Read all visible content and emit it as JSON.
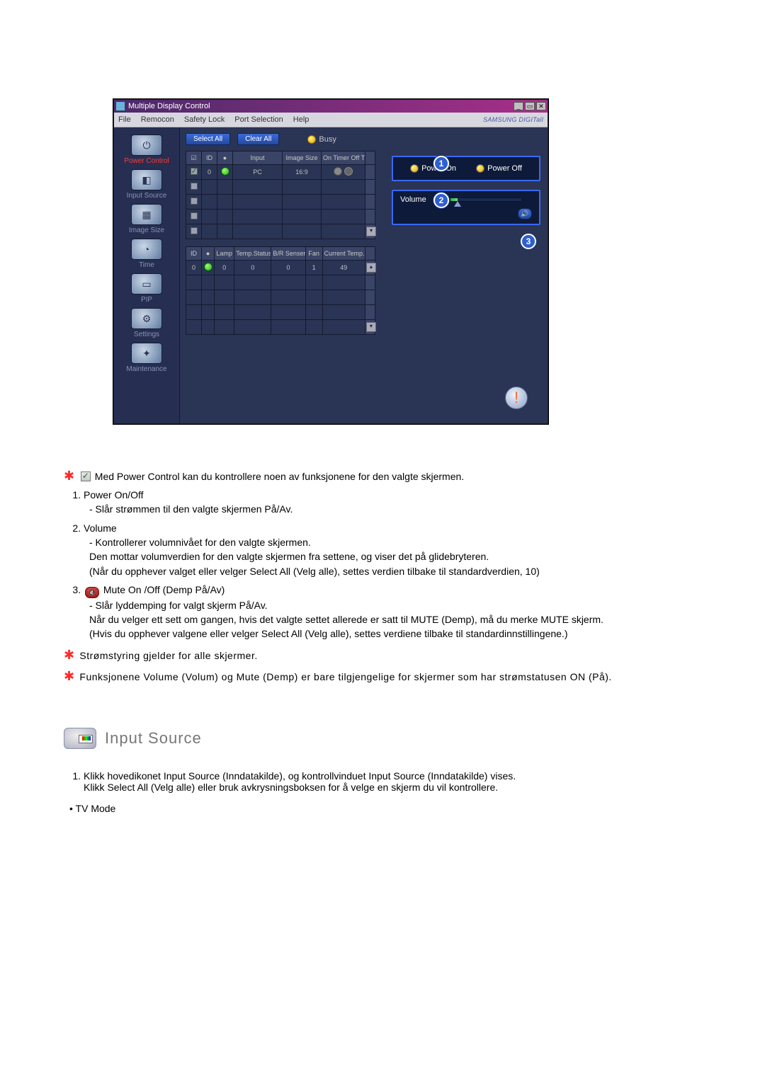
{
  "window": {
    "title": "Multiple Display Control",
    "menus": [
      "File",
      "Remocon",
      "Safety Lock",
      "Port Selection",
      "Help"
    ],
    "brand": "SAMSUNG DIGITall",
    "sidebar": [
      {
        "label": "Power Control",
        "glyph": "⏻"
      },
      {
        "label": "Input Source",
        "glyph": "◧"
      },
      {
        "label": "Image Size",
        "glyph": "▦"
      },
      {
        "label": "Time",
        "glyph": "◔"
      },
      {
        "label": "PIP",
        "glyph": "▭"
      },
      {
        "label": "Settings",
        "glyph": "⚙"
      },
      {
        "label": "Maintenance",
        "glyph": "✦"
      }
    ],
    "buttons": {
      "select_all": "Select All",
      "clear_all": "Clear All"
    },
    "busy_label": "Busy",
    "grid1": {
      "headers": [
        "",
        "ID",
        "",
        "Input",
        "Image Size",
        "On Timer Off T"
      ],
      "checkbox_header_glyph": "☑",
      "status_header_glyph": "●",
      "row": {
        "checked": true,
        "id": "0",
        "input": "PC",
        "image_size": "16:9"
      }
    },
    "grid2": {
      "headers": [
        "ID",
        "",
        "Lamp",
        "Temp.Status",
        "B/R Senser",
        "Fan",
        "Current Temp."
      ],
      "row": {
        "id": "0",
        "lamp": "0",
        "temp_status": "0",
        "br_sensor": "0",
        "fan": "1",
        "current_temp": "49"
      }
    },
    "panel_power": {
      "on": "Power On",
      "off": "Power Off"
    },
    "panel_volume": {
      "label": "Volume",
      "value": "10"
    },
    "callouts": {
      "c1": "1",
      "c2": "2",
      "c3": "3"
    },
    "alert_glyph": "!"
  },
  "instructions": {
    "intro": "Med Power Control kan du kontrollere noen av funksjonene for den valgte skjermen.",
    "items": [
      {
        "title": "Power On/Off",
        "lines": [
          "- Slår strømmen til den valgte skjermen På/Av."
        ]
      },
      {
        "title": "Volume",
        "lines": [
          "- Kontrollerer volumnivået for den valgte skjermen.",
          "Den mottar volumverdien for den valgte skjermen fra settene, og viser det på glidebryteren.",
          "(Når du opphever valget eller velger Select All (Velg alle), settes verdien tilbake til standardverdien, 10)"
        ]
      },
      {
        "title": "Mute On /Off (Demp På/Av)",
        "lines": [
          "- Slår lyddemping for valgt skjerm På/Av.",
          "Når du velger ett sett om gangen, hvis det valgte settet allerede er satt til MUTE (Demp), må du merke MUTE skjerm.",
          "(Hvis du opphever valgene eller velger Select All (Velg alle), settes verdiene tilbake til standardinnstillingene.)"
        ]
      }
    ],
    "notes": [
      "Strømstyring gjelder for alle skjermer.",
      "Funksjonene Volume (Volum) og Mute (Demp) er bare tilgjengelige for skjermer som har strømstatusen ON (På)."
    ]
  },
  "section": {
    "title": "Input Source",
    "num_item": "Klikk hovedikonet Input Source (Inndatakilde), og kontrollvinduet Input Source (Inndatakilde) vises.",
    "num_item2": "Klikk Select All (Velg alle) eller bruk avkrysningsboksen for å velge en skjerm du vil kontrollere.",
    "bullet": "TV Mode"
  }
}
